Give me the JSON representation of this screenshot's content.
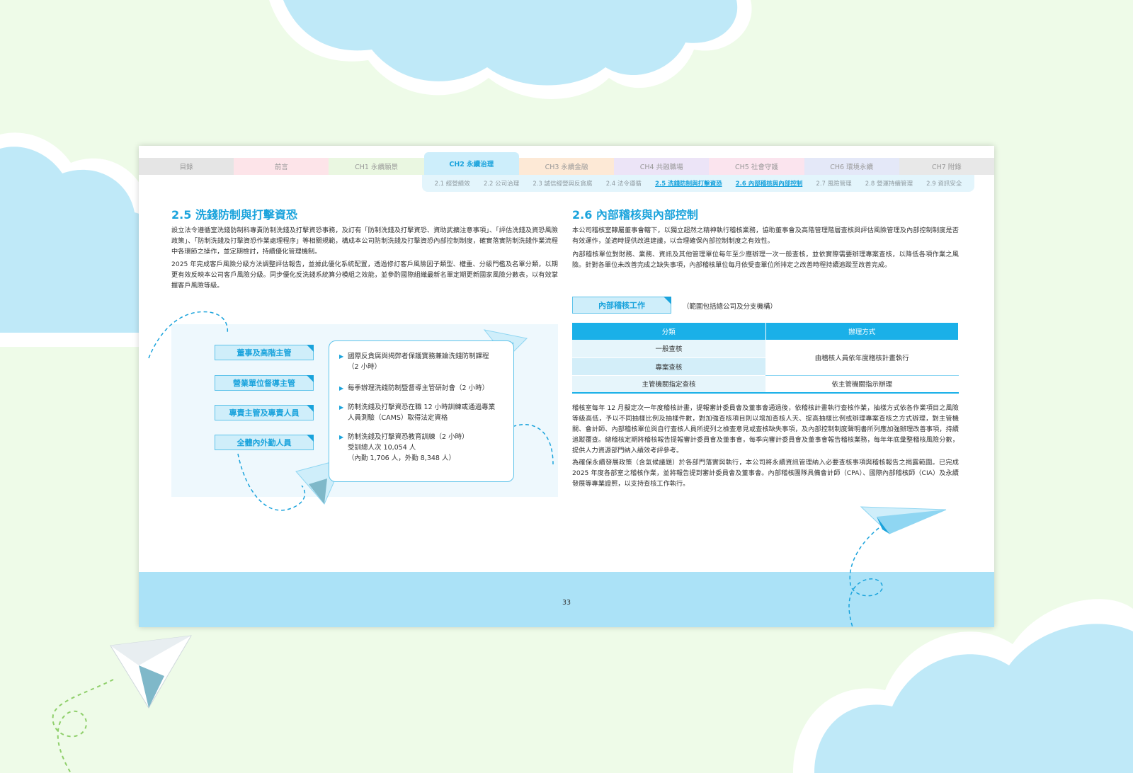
{
  "nav": {
    "tabs": [
      "目錄",
      "前言",
      "CH1 永續願景",
      "CH2 永續治理",
      "CH3 永續金融",
      "CH4 共融職場",
      "CH5 社會守護",
      "CH6 環境永續",
      "CH7 附錄"
    ],
    "tab_colors": [
      "#e5e5e5",
      "#fde4e9",
      "#eaf7e1",
      "#cdeefb",
      "#fde9d6",
      "#ece4f7",
      "#fbe4ee",
      "#e4e8f8",
      "#e8e8e8"
    ],
    "active_index": 3,
    "subnav": [
      "2.1 經營績效",
      "2.2 公司治理",
      "2.3 誠信經營與反貪腐",
      "2.4 法令遵循",
      "2.5 洗錢防制與打擊資恐",
      "2.6 內部稽核與內部控制",
      "2.7 風險管理",
      "2.8 營運持續管理",
      "2.9 資訊安全"
    ],
    "subnav_highlight": [
      4,
      5
    ]
  },
  "left": {
    "heading": "2.5 洗錢防制與打擊資恐",
    "para1": "設立法令遵循室洗錢防制科專責防制洗錢及打擊資恐事務，及訂有「防制洗錢及打擊資恐、資助武擴注意事項」、「評估洗錢及資恐風險政策」、「防制洗錢及打擊資恐作業處理程序」等相關規範，構成本公司防制洗錢及打擊資恐內部控制制度，確實落實防制洗錢作業流程中各環節之操作，並定期檢討，持續優化管理機制。",
    "para2": "2025 年完成客戶風險分級方法調整評估報告，並據此優化系統配置，透過修訂客戶風險因子類型、權重、分級門檻及名單分類，以期更有效反映本公司客戶風險分級。同步優化反洗錢系統算分模組之效能，並參酌國際組織最新名單定期更新國家風險分數表，以有效掌握客戶風險等級。",
    "roles": [
      "董事及高階主管",
      "營業單位督導主管",
      "專責主管及專責人員",
      "全體內外勤人員"
    ],
    "courses": [
      [
        "國際反貪腐與揭弊者保護實務兼論洗錢防制課程",
        "（2 小時）"
      ],
      [
        "每季辦理洗錢防制暨督導主管研討會（2 小時）"
      ],
      [
        "防制洗錢及打擊資恐在職 12 小時訓練或通過專業",
        "人員測驗（CAMS）取得法定資格"
      ],
      [
        "防制洗錢及打擊資恐教育訓練（2 小時）",
        "受訓總人次 10,054 人",
        "（內勤 1,706 人，外勤 8,348 人）"
      ]
    ]
  },
  "right": {
    "heading": "2.6 內部稽核與內部控制",
    "para1": "本公司稽核室隸屬董事會轄下，以獨立超然之精神執行稽核業務，協助董事會及高階管理階層查核與評估風險管理及內部控制制度是否有效運作，並適時提供改進建議，以合理確保內部控制制度之有效性。",
    "para2": "內部稽核單位對財務、業務、資訊及其他管理單位每年至少應辦理一次一般查核，並依實際需要辦理專案查核，以降低各項作業之風險。針對各單位未改善完成之缺失事項，內部稽核單位每月依受查單位所排定之改善時程持續追蹤至改善完成。",
    "tag": "內部稽核工作",
    "tag_note": "（範圍包括總公司及分支機構）",
    "table": {
      "headers": [
        "分類",
        "辦理方式"
      ],
      "rows": [
        [
          "一般查核",
          "由稽核人員依年度稽核計畫執行"
        ],
        [
          "專案查核",
          ""
        ],
        [
          "主管機關指定查核",
          "依主管機關指示辦理"
        ]
      ]
    },
    "para3": "稽核室每年 12 月擬定次一年度稽核計畫，提報審計委員會及董事會通過後，依稽核計畫執行查核作業，抽樣方式依各作業項目之風險等級高低，予以不同抽樣比例及抽樣件數，對加強查核項目則以增加查核人天、提高抽樣比例或辦理專案查核之方式辦理，對主管機關、會計師、內部稽核單位與自行查核人員所提列之檢查意見或查核缺失事項，及內部控制制度聲明書所列應加強辦理改善事項，持續追蹤覆查。總稽核定期將稽核報告提報審計委員會及董事會，每季向審計委員會及董事會報告稽核業務，每年年底彙整稽核風險分數，提供人力資源部門納入績效考評參考。",
    "para4": "為確保永續發展政策（含氣候議題）於各部門落實與執行，本公司將永續資訊管理納入必要查核事項與稽核報告之揭露範圍。已完成 2025 年度各部室之稽核作業，並將報告提到審計委員會及董事會。內部稽核團隊具備會計師（CPA）、國際內部稽核師（CIA）及永續發展等專業證照，以支持查核工作執行。"
  },
  "footer": {
    "page_number": "33"
  },
  "colors": {
    "accent": "#1aa3dc",
    "header_blue": "#1ab0e8",
    "cloud": "#bfe9f8",
    "footer": "#abe2f7"
  }
}
